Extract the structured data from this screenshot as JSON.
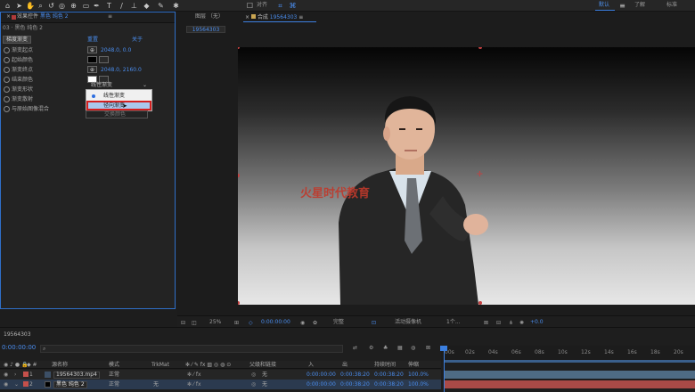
{
  "toolbar": {
    "snap_label": "对齐",
    "workspaces": {
      "default": "默认",
      "learn": "了解",
      "standard": "标准"
    }
  },
  "effect_controls": {
    "tab_label": "效果控件",
    "tab_layer": "黑色 纯色 2",
    "breadcrumb": "03 · 黑色 纯色 2",
    "effect_name": "梯度渐变",
    "reset_label": "重置",
    "about_label": "关于",
    "properties": [
      {
        "label": "渐变起点",
        "value": "2048.0, 0.0"
      },
      {
        "label": "起始颜色",
        "value": ""
      },
      {
        "label": "渐变终点",
        "value": "2048.0, 2160.0"
      },
      {
        "label": "结束颜色",
        "value": ""
      },
      {
        "label": "渐变形状",
        "value": ""
      },
      {
        "label": "渐变散射",
        "value": ""
      },
      {
        "label": "与原始图像混合",
        "value": ""
      }
    ],
    "shape_select_value": "线性渐变",
    "dropdown_options": [
      "线性渐变",
      "径向渐变"
    ],
    "dropdown_selected": "线性渐变",
    "dropdown_hovered": "径向渐变",
    "ghost_button": "交换颜色"
  },
  "composition": {
    "tab_layer": "图层 （无）",
    "tab_comp_prefix": "合成",
    "comp_name": "19564303",
    "subtab": "19564303",
    "watermark": "火星时代教育",
    "footer": {
      "zoom": "25%",
      "timecode": "0:00:00:00",
      "quality": "完整",
      "camera": "活动摄像机",
      "views": "1个...",
      "exposure": "+0.0"
    }
  },
  "timeline": {
    "tab_label": "19564303",
    "current_time": "0:00:00:00",
    "columns": [
      "源名称",
      "模式",
      "TrkMat",
      "父级和链接",
      "入",
      "出",
      "持续时间",
      "伸缩"
    ],
    "layers": [
      {
        "num": "1",
        "name": "19564303.mp4",
        "mode": "正常",
        "trkmat": "",
        "parent": "无",
        "in": "0:00:00:00",
        "out": "0:00:38:20",
        "duration": "0:00:38:20",
        "stretch": "100.0%",
        "color": "#c5504b"
      },
      {
        "num": "2",
        "name": "黑色 纯色 2",
        "mode": "正常",
        "trkmat": "无",
        "parent": "无",
        "in": "0:00:00:00",
        "out": "0:00:38:20",
        "duration": "0:00:38:20",
        "stretch": "100.0%",
        "color": "#c5504b"
      }
    ],
    "ruler_ticks": [
      "00s",
      "02s",
      "04s",
      "06s",
      "08s",
      "10s",
      "12s",
      "14s",
      "16s",
      "18s",
      "20s"
    ]
  }
}
